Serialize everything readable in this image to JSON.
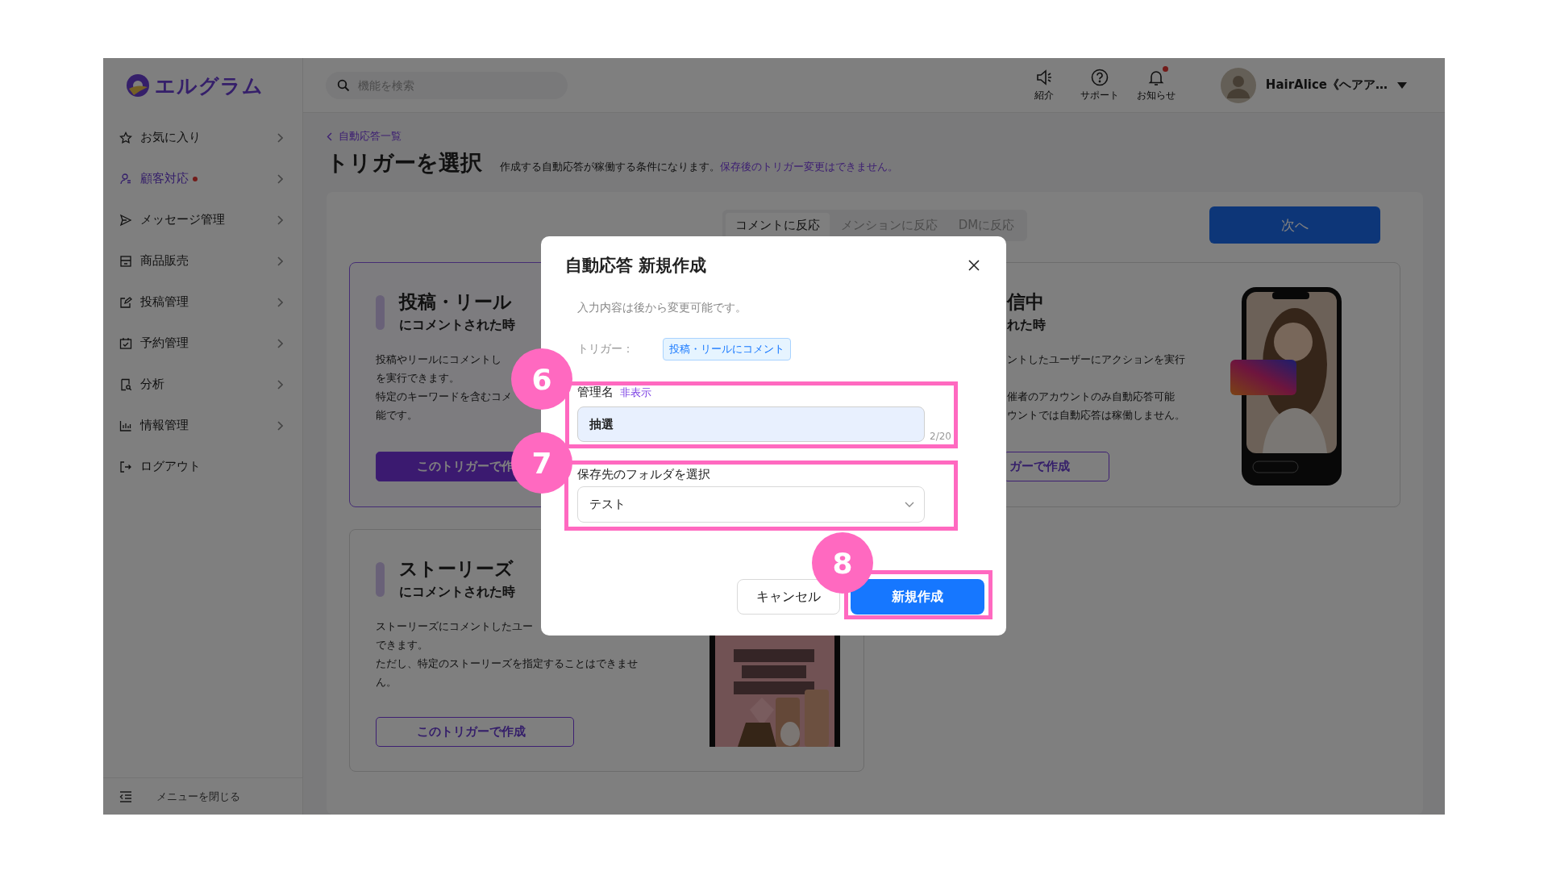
{
  "sidebar": {
    "logo": "エルグラム",
    "items": [
      {
        "label": "お気に入り",
        "kind": "star",
        "selected": false,
        "dot": false,
        "expandable": true
      },
      {
        "label": "顧客対応",
        "kind": "user",
        "selected": true,
        "dot": true,
        "expandable": true
      },
      {
        "label": "メッセージ管理",
        "kind": "send",
        "selected": false,
        "dot": false,
        "expandable": true
      },
      {
        "label": "商品販売",
        "kind": "store",
        "selected": false,
        "dot": false,
        "expandable": true
      },
      {
        "label": "投稿管理",
        "kind": "edit",
        "selected": false,
        "dot": false,
        "expandable": true
      },
      {
        "label": "予約管理",
        "kind": "calendar",
        "selected": false,
        "dot": false,
        "expandable": true
      },
      {
        "label": "分析",
        "kind": "report",
        "selected": false,
        "dot": false,
        "expandable": true
      },
      {
        "label": "情報管理",
        "kind": "chart",
        "selected": false,
        "dot": false,
        "expandable": true
      },
      {
        "label": "ログアウト",
        "kind": "logout",
        "selected": false,
        "dot": false,
        "expandable": false
      }
    ],
    "collapse": "メニューを閉じる"
  },
  "topbar": {
    "search": {
      "placeholder": "機能を検索"
    },
    "actions": [
      {
        "label": "紹介",
        "kind": "megaphone",
        "dot": false
      },
      {
        "label": "サポート",
        "kind": "help",
        "dot": false
      },
      {
        "label": "お知らせ",
        "kind": "bell",
        "dot": true
      }
    ],
    "user": {
      "name": "HairAlice《ヘアア…"
    }
  },
  "page": {
    "back_link": "自動応答一覧",
    "title": "トリガーを選択",
    "description": "作成する自動応答が稼働する条件になります。",
    "notice": "保存後のトリガー変更はできません。",
    "tabs": [
      {
        "label": "コメントに反応",
        "selected": true
      },
      {
        "label": "メンションに反応",
        "selected": false
      },
      {
        "label": "DMに反応",
        "selected": false
      }
    ],
    "next_button": "次へ"
  },
  "cards": [
    {
      "title": "投稿・リール",
      "subtitle": "にコメントされた時",
      "description": [
        "投稿やリールにコメントし",
        "を実行できます。",
        "特定のキーワードを含むコメ",
        "能です。"
      ],
      "button": "このトリガーで作",
      "selected": true
    },
    {
      "title": "信中",
      "subtitle": "れた時",
      "description": [
        "ントしたユーザーにアクションを実行",
        "催者のアカウントのみ自動応答可能",
        "ウントでは自動応答は稼働しません。"
      ],
      "button": "ガーで作成",
      "selected": false
    },
    {
      "title": "ストーリーズ",
      "subtitle": "にコメントされた時",
      "description": [
        "ストーリーズにコメントしたユー",
        "できます。",
        "ただし、特定のストーリーズを指定することはできませ",
        "ん。"
      ],
      "button": "このトリガーで作成",
      "selected": false
    }
  ],
  "dialog": {
    "title": "自動応答 新規作成",
    "subtitle": "入力内容は後から変更可能です。",
    "trigger_label": "トリガー：",
    "trigger_tag": "投稿・リールにコメント",
    "name_field": {
      "label": "管理名",
      "toggle": "非表示",
      "value": "抽選",
      "counter": "2/20"
    },
    "folder_field": {
      "label": "保存先のフォルダを選択",
      "value": "テスト"
    },
    "buttons": [
      {
        "label": "キャンセル",
        "kind": "secondary"
      },
      {
        "label": "新規作成",
        "kind": "primary"
      }
    ]
  },
  "annotations": [
    {
      "number": "6"
    },
    {
      "number": "7"
    },
    {
      "number": "8"
    }
  ]
}
